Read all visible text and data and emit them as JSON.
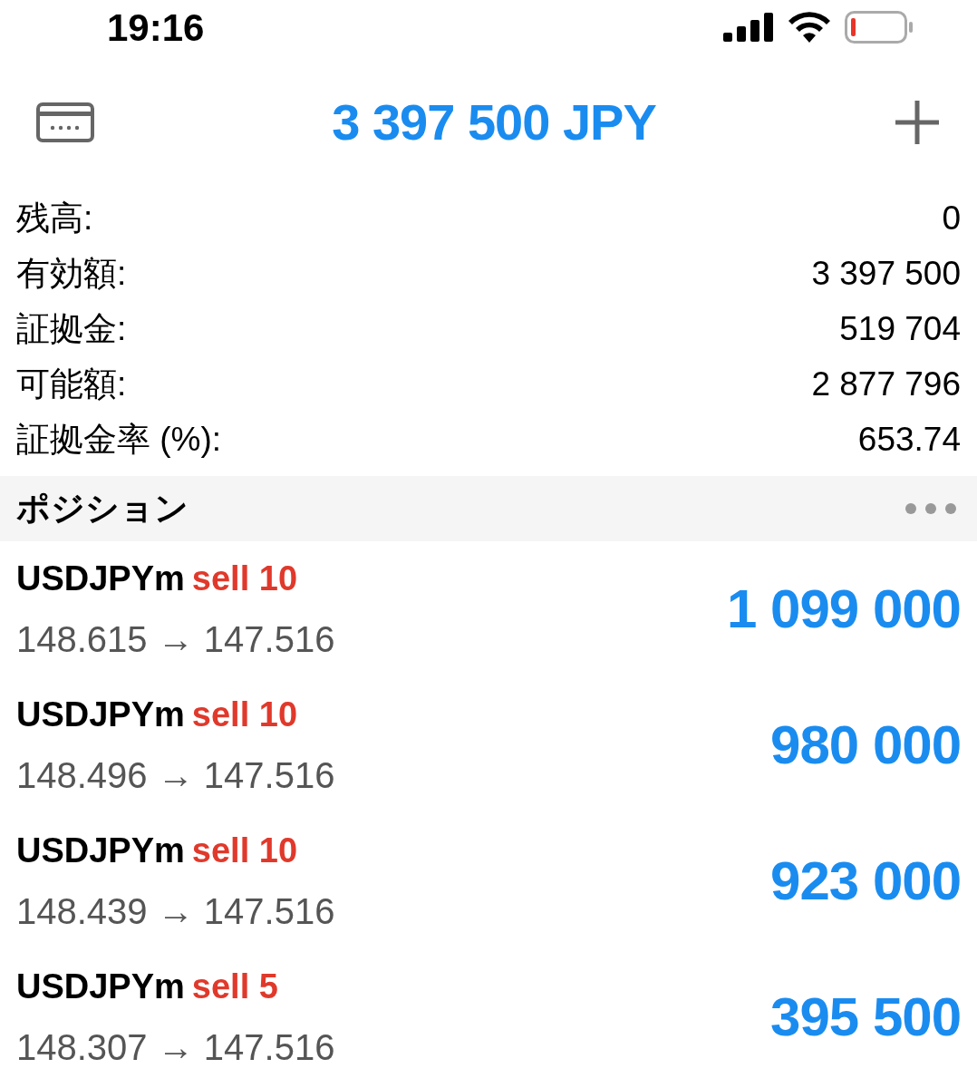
{
  "status_bar": {
    "time": "19:16"
  },
  "header": {
    "title": "3 397 500 JPY"
  },
  "summary": [
    {
      "label": "残高:",
      "value": "0"
    },
    {
      "label": "有効額:",
      "value": "3 397 500"
    },
    {
      "label": "証拠金:",
      "value": "519 704"
    },
    {
      "label": "可能額:",
      "value": "2 877 796"
    },
    {
      "label": "証拠金率 (%):",
      "value": "653.74"
    }
  ],
  "section": {
    "title": "ポジション"
  },
  "positions": [
    {
      "symbol": "USDJPYm",
      "order": "sell 10",
      "prices": "148.615 → 147.516",
      "profit": "1 099 000"
    },
    {
      "symbol": "USDJPYm",
      "order": "sell 10",
      "prices": "148.496 → 147.516",
      "profit": "980 000"
    },
    {
      "symbol": "USDJPYm",
      "order": "sell 10",
      "prices": "148.439 → 147.516",
      "profit": "923 000"
    },
    {
      "symbol": "USDJPYm",
      "order": "sell 5",
      "prices": "148.307 → 147.516",
      "profit": "395 500"
    }
  ]
}
